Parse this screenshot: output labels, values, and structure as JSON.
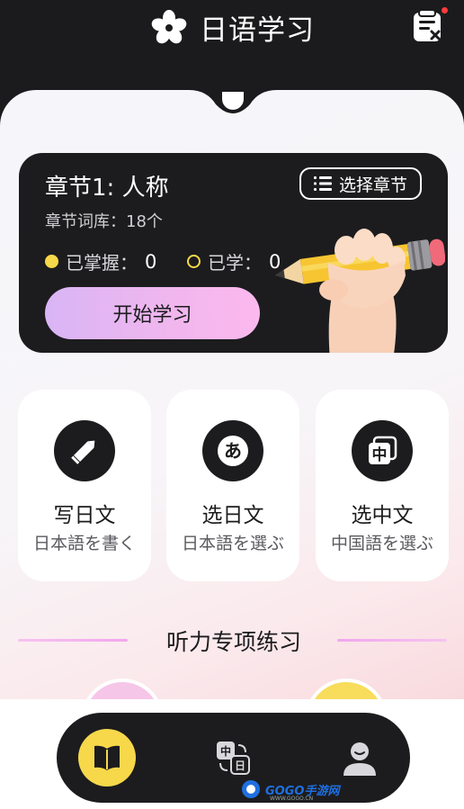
{
  "header": {
    "app_title": "日语学习",
    "logo_icon": "sakura-icon",
    "notes_icon": "checklist-icon",
    "has_notification": true
  },
  "chapter": {
    "title": "章节1: 人称",
    "select_label": "选择章节",
    "vocab_count": "章节词库：18个",
    "mastered_label": "已掌握：",
    "mastered_value": "0",
    "learned_label": "已学：",
    "learned_value": "0",
    "start_label": "开始学习"
  },
  "modes": [
    {
      "title": "写日文",
      "subtitle": "日本語を書く",
      "icon": "pencil-icon"
    },
    {
      "title": "选日文",
      "subtitle": "日本語を選ぶ",
      "icon": "hiragana-a-icon"
    },
    {
      "title": "选中文",
      "subtitle": "中国語を選ぶ",
      "icon": "chinese-char-icon"
    }
  ],
  "listening": {
    "title": "听力专项练习"
  },
  "nav": {
    "items": [
      {
        "name": "home",
        "icon": "book-icon",
        "active": true
      },
      {
        "name": "translate",
        "icon": "translate-icon",
        "active": false
      },
      {
        "name": "profile",
        "icon": "user-icon",
        "active": false
      }
    ]
  },
  "watermark": {
    "text": "GOGO手游网",
    "sub": "WWW.GOGO.CN"
  },
  "colors": {
    "accent": "#f7d84a",
    "dark": "#1c1c1e",
    "button_gradient_start": "#d9b5f5",
    "button_gradient_end": "#fbb9ee",
    "section_line": "#f2a6ee"
  }
}
